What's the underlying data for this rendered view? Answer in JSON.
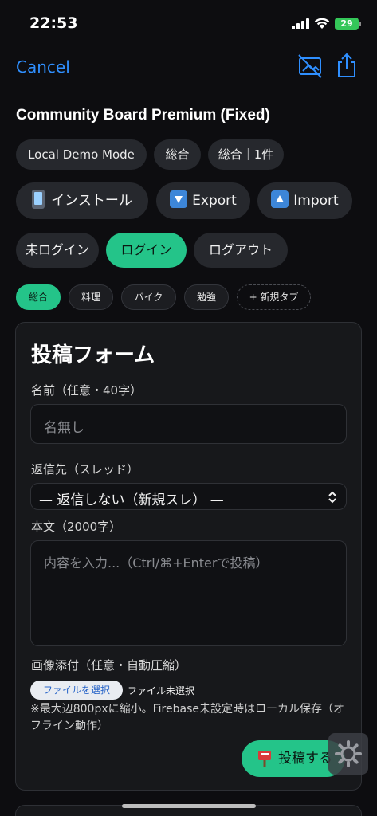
{
  "status_bar": {
    "time": "22:53",
    "battery": "29"
  },
  "nav": {
    "cancel": "Cancel",
    "icons": [
      "no-image-icon",
      "share-icon"
    ]
  },
  "title": "Community Board Premium (Fixed)",
  "badges": {
    "mode": "Local Demo Mode",
    "board": "総合",
    "count": "総合｜1件"
  },
  "actions": {
    "install": "インストール",
    "export": "Export",
    "import": "Import"
  },
  "auth": {
    "status": "未ログイン",
    "login": "ログイン",
    "logout": "ログアウト"
  },
  "tabs": [
    {
      "label": "総合",
      "active": true
    },
    {
      "label": "料理"
    },
    {
      "label": "バイク"
    },
    {
      "label": "勉強"
    },
    {
      "label": "+ 新規タブ"
    }
  ],
  "form": {
    "heading": "投稿フォーム",
    "name_label": "名前（任意・40字）",
    "name_placeholder": "名無し",
    "reply_label": "返信先（スレッド）",
    "reply_selected": "— 返信しない（新規スレ） —",
    "body_label": "本文（2000字）",
    "body_placeholder": "内容を入力...（Ctrl/⌘+Enterで投稿）",
    "image_label": "画像添付（任意・自動圧縮）",
    "file_button": "ファイルを選択",
    "file_status": "ファイル未選択",
    "note": "※最大辺800pxに縮小。Firebase未設定時はローカル保存（オフライン動作）",
    "submit": "投稿する"
  },
  "colors": {
    "accent": "#24c489",
    "link": "#2f8fff",
    "background": "#0d0d10"
  }
}
